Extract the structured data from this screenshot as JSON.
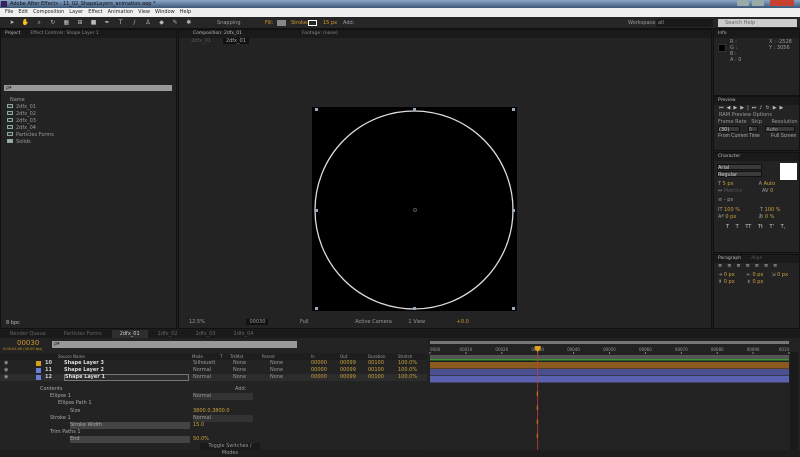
{
  "window": {
    "title": "Adobe After Effects - 11_02_ShapeLayers_animation.aep *"
  },
  "menu": [
    "File",
    "Edit",
    "Composition",
    "Layer",
    "Effect",
    "Animation",
    "View",
    "Window",
    "Help"
  ],
  "toolbar": {
    "snapping": "Snapping",
    "fill": "Fill:",
    "stroke": "Stroke:",
    "stroke_width": "15 px",
    "add": "Add:",
    "workspace_label": "Workspace:",
    "workspace": "all",
    "search_placeholder": "Search Help"
  },
  "project": {
    "tab": "Project",
    "effect_controls_tab": "Effect Controls: Shape Layer 1",
    "search": "ρ▾",
    "column_name": "Name",
    "items": [
      "2dfx_01",
      "2dfx_02",
      "2dfx_03",
      "2dfx_04",
      "Particles Forms",
      "Solids"
    ],
    "bpc": "8 bpc"
  },
  "composition": {
    "tab": "Composition: 2dfx_01",
    "footage_tab": "Footage: (none)",
    "breadcrumbs": [
      "2dfx_01",
      "2dfx_01"
    ],
    "zoom": "12.5%",
    "timecode": "00030",
    "resolution": "Full",
    "camera": "Active Camera",
    "views": "1 View",
    "exposure": "+0.0"
  },
  "info": {
    "tab": "Info",
    "r": "R :",
    "g": "G :",
    "b": "B :",
    "a": "A : 0",
    "x": "X : -2528",
    "y": "Y : 3056"
  },
  "preview": {
    "tab": "Preview",
    "ram_options": "RAM Preview Options",
    "frame_rate_label": "Frame Rate",
    "skip_label": "Skip",
    "resolution_label": "Resolution",
    "frame_rate": "(30)",
    "skip": "0",
    "resolution": "Auto",
    "from_current": "From Current Time",
    "full_screen": "Full Screen"
  },
  "character": {
    "tab": "Character",
    "font": "Arial",
    "style": "Regular",
    "size": "5 px",
    "leading": "Auto",
    "kerning": "Metrics",
    "tracking": "0",
    "stroke_width": "- px",
    "vscale": "100 %",
    "hscale": "100 %",
    "baseline": "0 px",
    "tsume": "0 %",
    "styles": [
      "T",
      "T",
      "TT",
      "Tt",
      "T'",
      "T,"
    ]
  },
  "paragraph": {
    "tab": "Paragraph",
    "align_tab": "Align",
    "indent_left": "0 px",
    "indent_right": "0 px",
    "indent_first": "0 px",
    "space_before": "0 px",
    "space_after": "0 px"
  },
  "tabs": [
    "Render Queue",
    "Particles Forms",
    "2dfx_01",
    "2dfx_02",
    "2dfx_03",
    "2dfx_04"
  ],
  "timeline": {
    "timecode": "00030",
    "timecode_sub": "0:00:01:00 (30.00 fps)",
    "search": "ρ▾",
    "columns": {
      "source": "Source Name",
      "mode": "Mode",
      "t": "T",
      "trkmat": "TrkMat",
      "parent": "Parent",
      "in": "In",
      "out": "Out",
      "duration": "Duration",
      "stretch": "Stretch"
    },
    "layers": [
      {
        "num": "10",
        "name": "Shape Layer 3",
        "color": "#d4a020",
        "mode": "Silhouett",
        "trkmat": "None",
        "parent": "None",
        "in": "00000",
        "out": "00099",
        "duration": "00100",
        "stretch": "100.0%"
      },
      {
        "num": "11",
        "name": "Shape Layer 2",
        "color": "#6a7ed8",
        "mode": "Normal",
        "trkmat": "None",
        "parent": "None",
        "in": "00000",
        "out": "00099",
        "duration": "00100",
        "stretch": "100.0%"
      },
      {
        "num": "12",
        "name": "Shape Layer 1",
        "color": "#6a7ed8",
        "mode": "Normal",
        "trkmat": "None",
        "parent": "None",
        "in": "00000",
        "out": "00099",
        "duration": "00100",
        "stretch": "100.0%"
      }
    ],
    "props": {
      "contents": "Contents",
      "add": "Add:",
      "ellipse": "Ellipse 1",
      "ellipse_mode": "Normal",
      "ellipse_path": "Ellipse Path 1",
      "size_label": "Size",
      "size": "3800.0,3800.0",
      "stroke": "Stroke 1",
      "stroke_mode": "Normal",
      "stroke_width_label": "Stroke Width",
      "stroke_width": "15.0",
      "trim": "Trim Paths 1",
      "end_label": "End",
      "end": "50.0%"
    },
    "toggle": "Toggle Switches / Modes",
    "ruler": [
      "0000",
      "00010",
      "00020",
      "00030",
      "00040",
      "00050",
      "00060",
      "00070",
      "00080",
      "00090",
      "0010"
    ],
    "current_frame": 30,
    "total_frames": 100
  },
  "colors": {
    "accent": "#d49a2a",
    "playhead": "#c83c3c",
    "bar_orange": "#8a5a20",
    "bar_blue": "#4a4f90",
    "bar_green": "#3a9a30"
  }
}
